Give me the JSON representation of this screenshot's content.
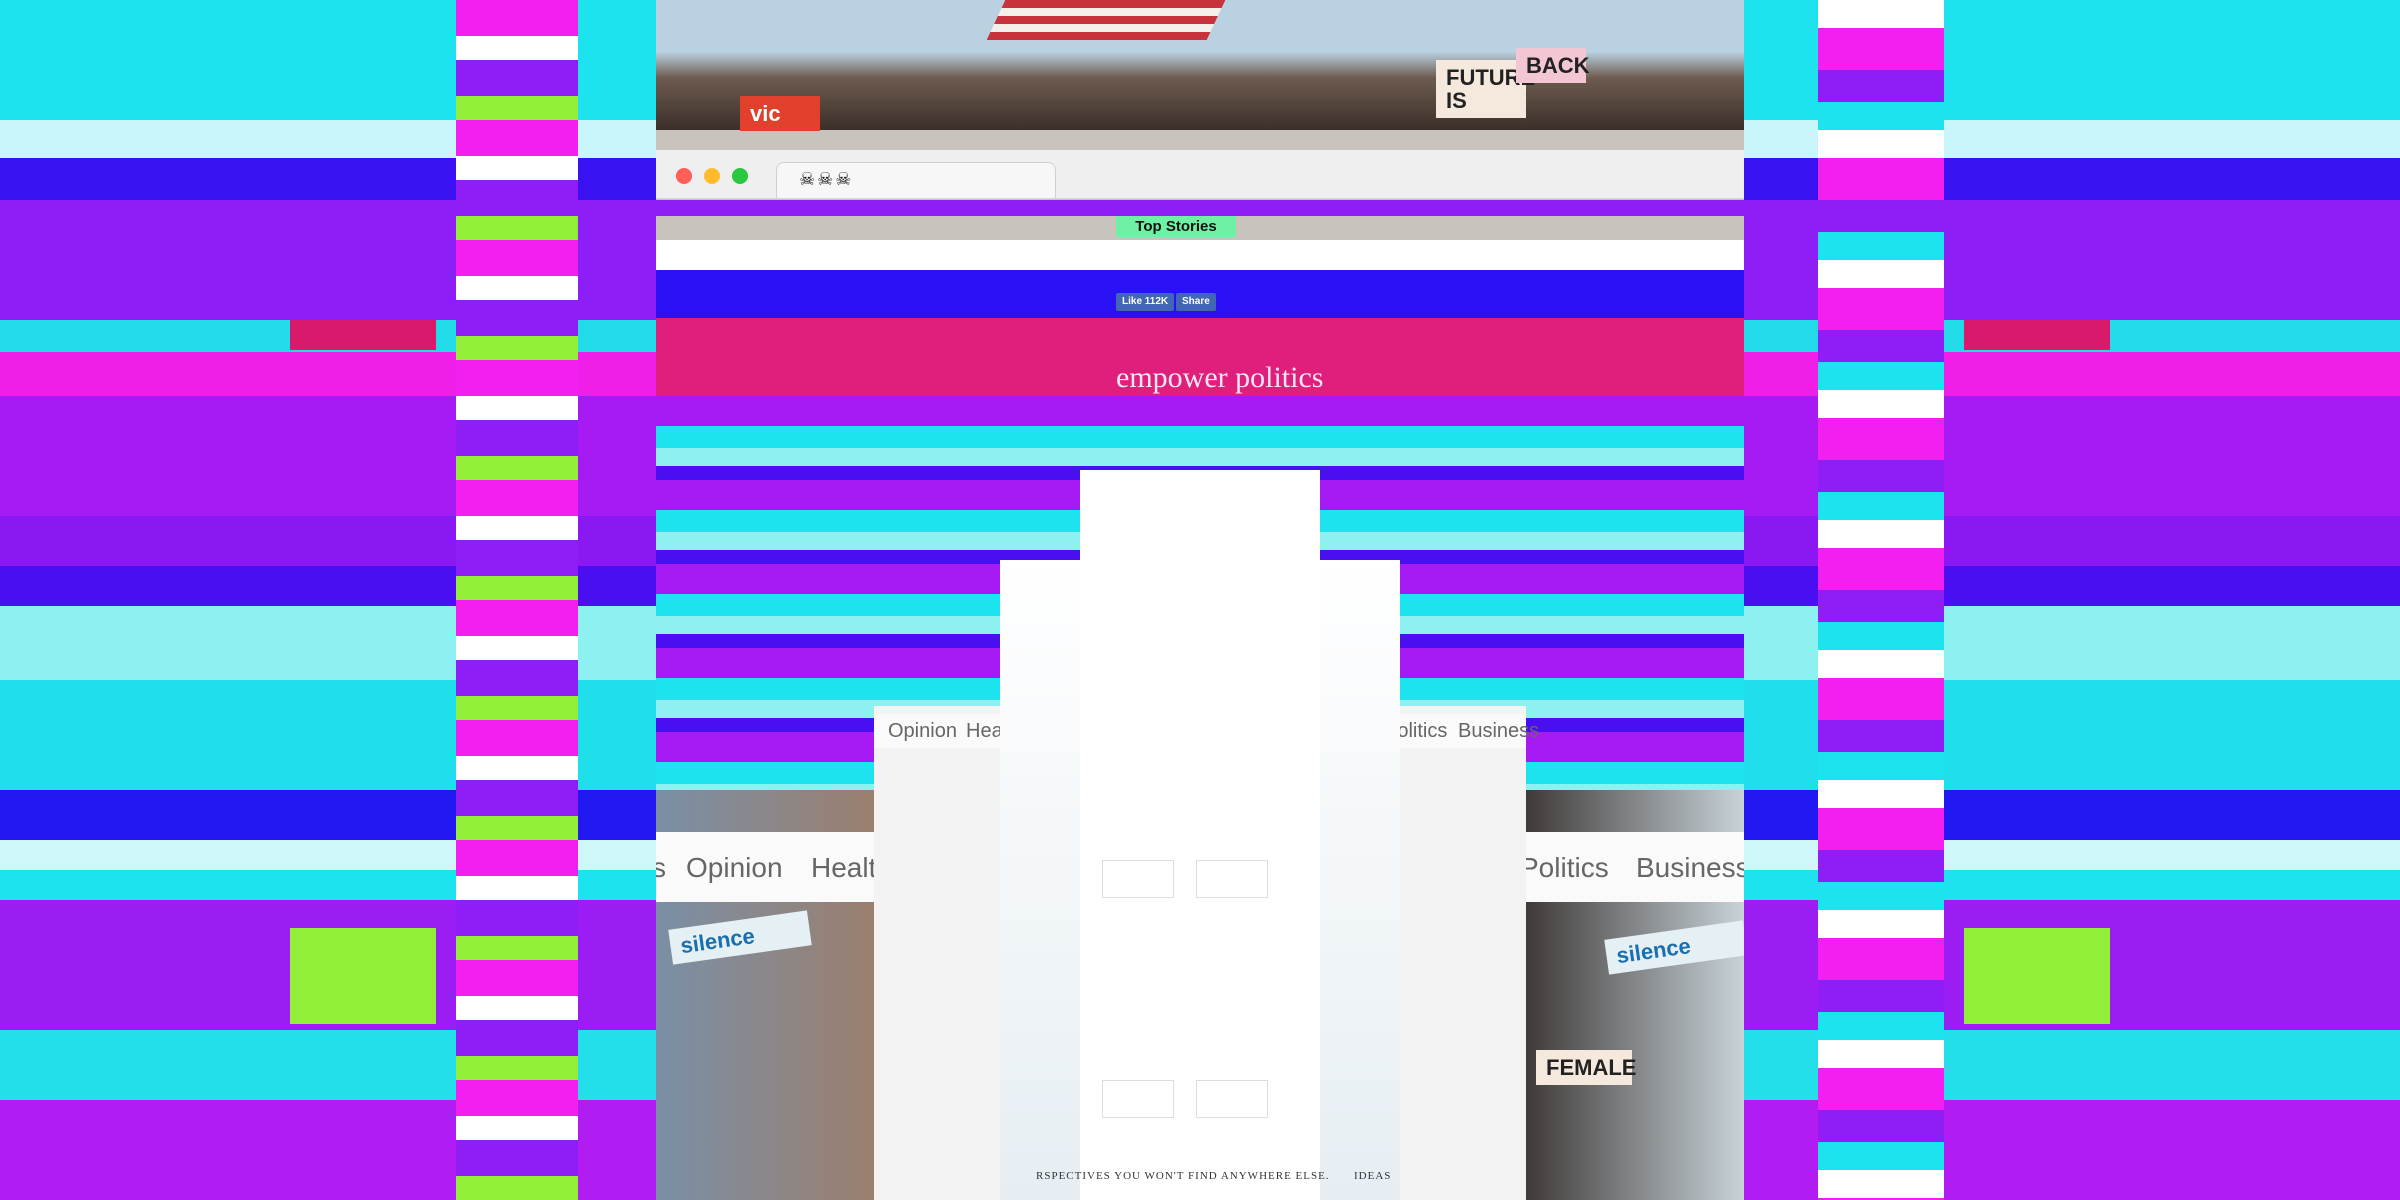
{
  "browser": {
    "tab_title": "☠☠☠",
    "window_controls": [
      "close",
      "minimize",
      "maximize"
    ]
  },
  "page": {
    "top_stories": "Top Stories",
    "like_label": "Like 112K",
    "share_label": "Share",
    "headline": "empower politics",
    "nav": [
      "Opinion",
      "Health",
      "Politics",
      "Business"
    ],
    "nav_partial_left": "s",
    "perspectives_text": "RSPECTIVES YOU WON'T FIND ANYWHERE ELSE.",
    "ideas_label": "IDEAS",
    "silence_sign": "silence",
    "future_sign": "FUTURE IS",
    "back_sign": "BACK",
    "vic_sign": "vic",
    "female_sign": "FEMALE"
  },
  "colors": {
    "cyan": "#1de3ee",
    "violet": "#a21cf5",
    "blue": "#2a10f5",
    "magenta": "#f31ff0",
    "lime": "#93ee3a",
    "white": "#ffffff"
  }
}
